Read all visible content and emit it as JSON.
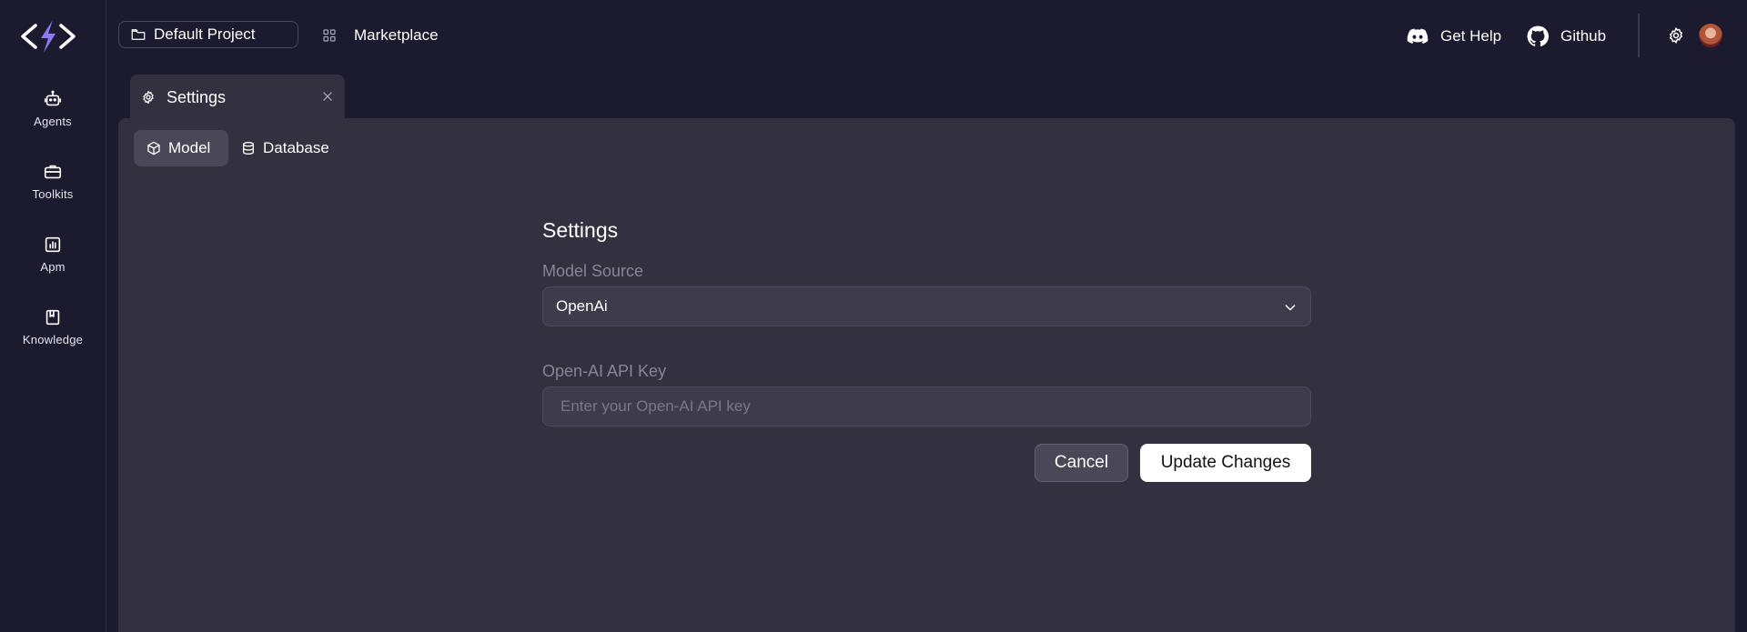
{
  "sidebar": {
    "items": [
      {
        "label": "Agents",
        "icon": "robot-icon"
      },
      {
        "label": "Toolkits",
        "icon": "toolbox-icon"
      },
      {
        "label": "Apm",
        "icon": "chart-icon"
      },
      {
        "label": "Knowledge",
        "icon": "book-icon"
      }
    ]
  },
  "topbar": {
    "project_label": "Default Project",
    "marketplace_label": "Marketplace",
    "help_label": "Get Help",
    "github_label": "Github"
  },
  "tabs": [
    {
      "label": "Settings",
      "icon": "gear-icon"
    }
  ],
  "subtabs": [
    {
      "label": "Model",
      "icon": "cube-icon",
      "active": true
    },
    {
      "label": "Database",
      "icon": "database-icon",
      "active": false
    }
  ],
  "form": {
    "title": "Settings",
    "model_source_label": "Model Source",
    "model_source_value": "OpenAi",
    "api_key_label": "Open-AI API Key",
    "api_key_placeholder": "Enter your Open-AI API key",
    "api_key_value": "",
    "cancel_label": "Cancel",
    "update_label": "Update Changes"
  },
  "colors": {
    "background": "#1c1a2e",
    "panel": "#33303f",
    "accent": "#8b7cf6"
  }
}
